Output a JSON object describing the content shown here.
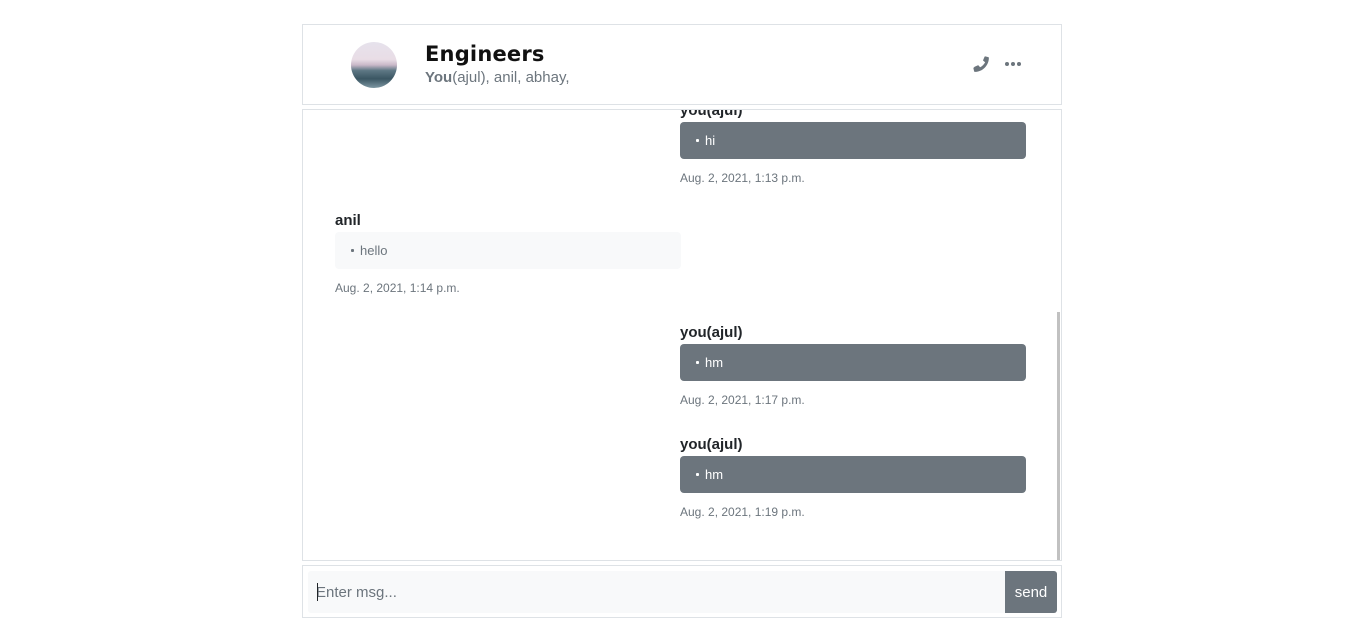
{
  "header": {
    "title": "Engineers",
    "members_you": "You",
    "members_rest": "(ajul), anil, abhay,",
    "avatar_icon": "group-avatar",
    "phone_icon": "phone-icon",
    "more_icon": "ellipsis-icon"
  },
  "messages": [
    {
      "sender": "you(ajul)",
      "text": "hi",
      "time": "Aug. 2, 2021, 1:13 p.m.",
      "own": true
    },
    {
      "sender": "anil",
      "text": "hello",
      "time": "Aug. 2, 2021, 1:14 p.m.",
      "own": false
    },
    {
      "sender": "you(ajul)",
      "text": "hm",
      "time": "Aug. 2, 2021, 1:17 p.m.",
      "own": true
    },
    {
      "sender": "you(ajul)",
      "text": "hm",
      "time": "Aug. 2, 2021, 1:19 p.m.",
      "own": true
    }
  ],
  "composer": {
    "placeholder": "Enter msg...",
    "value": "",
    "send_label": "send"
  },
  "colors": {
    "own_bubble": "#6c757d",
    "other_bubble": "#f8f9fa",
    "muted_text": "#6c757d",
    "border": "#dee2e6"
  }
}
